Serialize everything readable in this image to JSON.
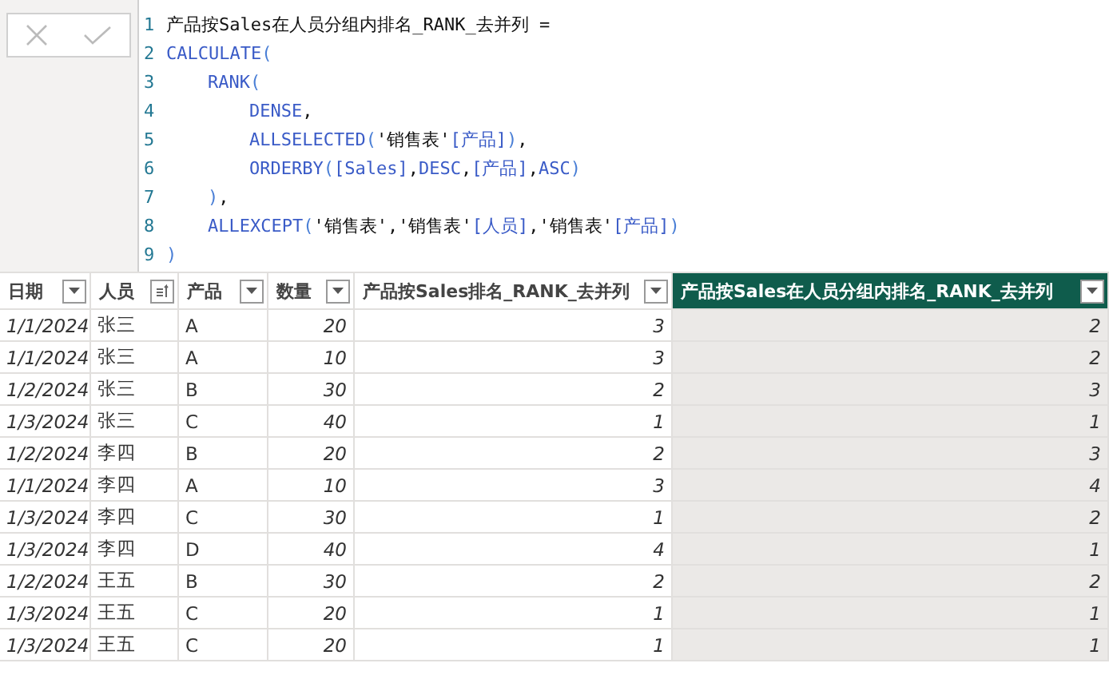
{
  "formula_bar": {
    "lines": [
      {
        "number": "1",
        "tokens": [
          {
            "kind": "text",
            "text": "产品按Sales在人员分组内排名_RANK_去并列 ="
          }
        ]
      },
      {
        "number": "2",
        "tokens": [
          {
            "kind": "keyword",
            "text": "CALCULATE"
          },
          {
            "kind": "punct",
            "text": "("
          }
        ]
      },
      {
        "number": "3",
        "tokens": [
          {
            "kind": "keyword",
            "text": "RANK"
          },
          {
            "kind": "punct",
            "text": "("
          }
        ]
      },
      {
        "number": "4",
        "tokens": [
          {
            "kind": "keyword",
            "text": "DENSE"
          },
          {
            "kind": "text",
            "text": ","
          }
        ]
      },
      {
        "number": "5",
        "tokens": [
          {
            "kind": "keyword",
            "text": "ALLSELECTED"
          },
          {
            "kind": "punct",
            "text": "("
          },
          {
            "kind": "text",
            "text": "'销售表'"
          },
          {
            "kind": "column",
            "text": "[产品]"
          },
          {
            "kind": "punct",
            "text": ")"
          },
          {
            "kind": "text",
            "text": ","
          }
        ]
      },
      {
        "number": "6",
        "tokens": [
          {
            "kind": "keyword",
            "text": "ORDERBY"
          },
          {
            "kind": "punct",
            "text": "("
          },
          {
            "kind": "column",
            "text": "[Sales]"
          },
          {
            "kind": "text",
            "text": ","
          },
          {
            "kind": "keyword",
            "text": "DESC"
          },
          {
            "kind": "text",
            "text": ","
          },
          {
            "kind": "column",
            "text": "[产品]"
          },
          {
            "kind": "text",
            "text": ","
          },
          {
            "kind": "keyword",
            "text": "ASC"
          },
          {
            "kind": "punct",
            "text": ")"
          }
        ]
      },
      {
        "number": "7",
        "tokens": [
          {
            "kind": "punct",
            "text": ")"
          },
          {
            "kind": "text",
            "text": ","
          }
        ]
      },
      {
        "number": "8",
        "tokens": [
          {
            "kind": "keyword",
            "text": "ALLEXCEPT"
          },
          {
            "kind": "punct",
            "text": "("
          },
          {
            "kind": "text",
            "text": "'销售表','销售表'"
          },
          {
            "kind": "column",
            "text": "[人员]"
          },
          {
            "kind": "text",
            "text": ",'销售表'"
          },
          {
            "kind": "column",
            "text": "[产品]"
          },
          {
            "kind": "punct",
            "text": ")"
          }
        ]
      },
      {
        "number": "9",
        "tokens": [
          {
            "kind": "punct",
            "text": ")"
          }
        ]
      }
    ]
  },
  "table": {
    "columns": [
      {
        "label": "日期",
        "kind": "date",
        "sorted": false,
        "selected": false
      },
      {
        "label": "人员",
        "kind": "text",
        "sorted": true,
        "selected": false
      },
      {
        "label": "产品",
        "kind": "text",
        "sorted": false,
        "selected": false
      },
      {
        "label": "数量",
        "kind": "number",
        "sorted": false,
        "selected": false
      },
      {
        "label": "产品按Sales排名_RANK_去并列",
        "kind": "number",
        "sorted": false,
        "selected": false
      },
      {
        "label": "产品按Sales在人员分组内排名_RANK_去并列",
        "kind": "number",
        "sorted": false,
        "selected": true
      }
    ],
    "rows": [
      [
        "1/1/2024",
        "张三",
        "A",
        "20",
        "3",
        "2"
      ],
      [
        "1/1/2024",
        "张三",
        "A",
        "10",
        "3",
        "2"
      ],
      [
        "1/2/2024",
        "张三",
        "B",
        "30",
        "2",
        "3"
      ],
      [
        "1/3/2024",
        "张三",
        "C",
        "40",
        "1",
        "1"
      ],
      [
        "1/2/2024",
        "李四",
        "B",
        "20",
        "2",
        "3"
      ],
      [
        "1/1/2024",
        "李四",
        "A",
        "10",
        "3",
        "4"
      ],
      [
        "1/3/2024",
        "李四",
        "C",
        "30",
        "1",
        "2"
      ],
      [
        "1/3/2024",
        "李四",
        "D",
        "40",
        "4",
        "1"
      ],
      [
        "1/2/2024",
        "王五",
        "B",
        "30",
        "2",
        "2"
      ],
      [
        "1/3/2024",
        "王五",
        "C",
        "20",
        "1",
        "1"
      ],
      [
        "1/3/2024",
        "王五",
        "C",
        "20",
        "1",
        "1"
      ]
    ]
  }
}
